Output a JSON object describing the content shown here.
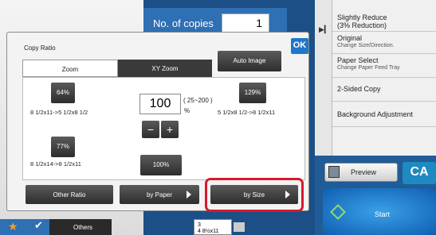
{
  "background": {
    "copies_label": "No. of copies",
    "copies_value": "1",
    "right_panel": [
      {
        "title": "Slightly Reduce",
        "sub": "(3% Reduction)"
      },
      {
        "title": "Original",
        "sub": "Change Size/Direction."
      },
      {
        "title": "Paper Select",
        "sub": "Change Paper Feed Tray"
      },
      {
        "title": "2-Sided Copy",
        "sub": ""
      },
      {
        "title": "Background Adjustment",
        "sub": ""
      }
    ],
    "preview_label": "Preview",
    "ca_label": "CA",
    "start_label": "Start",
    "others_label": "Others",
    "size_lines": [
      "3",
      "4  8½x11"
    ]
  },
  "dialog": {
    "title": "Copy Ratio",
    "ok_label": "OK",
    "tabs": [
      {
        "label": "Zoom",
        "active": true
      },
      {
        "label": "XY Zoom",
        "active": false
      }
    ],
    "auto_image_label": "Auto Image",
    "presets": [
      {
        "label": "64%",
        "desc": "8 1/2x11->5 1/2x8 1/2"
      },
      {
        "label": "77%",
        "desc": "8 1/2x14->8 1/2x11"
      },
      {
        "label": "129%",
        "desc": "5 1/2x8 1/2->8 1/2x11"
      },
      {
        "label": "100%",
        "desc": ""
      }
    ],
    "ratio_value": "100",
    "range_text": "( 25~200 )",
    "percent_sign": "%",
    "minus_label": "−",
    "plus_label": "+",
    "bottom_buttons": {
      "other_ratio": "Other Ratio",
      "by_paper": "by Paper",
      "by_size": "by Size"
    }
  },
  "colors": {
    "accent_blue": "#1f77c9",
    "highlight_red": "#d9182c",
    "button_dark": "#2d2d2d"
  }
}
